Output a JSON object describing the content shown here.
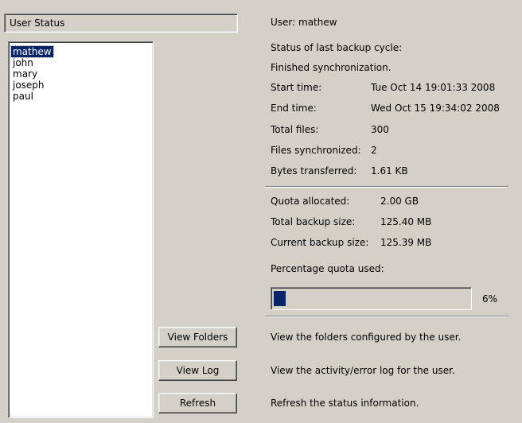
{
  "header": {
    "title": "User Status"
  },
  "users": {
    "selected_index": 0,
    "items": [
      "mathew",
      "john",
      "mary",
      "joseph",
      "paul"
    ]
  },
  "status": {
    "user_line": "User: mathew",
    "last_cycle_label": "Status of last backup cycle:",
    "last_cycle_value": "Finished synchronization.",
    "start_label": "Start time:",
    "start_value": "Tue Oct 14 19:01:33 2008",
    "end_label": "End time:",
    "end_value": "Wed Oct 15 19:34:02 2008",
    "total_files_label": "Total files:",
    "total_files_value": "300",
    "files_synced_label": "Files synchronized:",
    "files_synced_value": "2",
    "bytes_label": "Bytes transferred:",
    "bytes_value": "1.61 KB"
  },
  "quota": {
    "allocated_label": "Quota allocated:",
    "allocated_value": "2.00 GB",
    "total_label": "Total backup size:",
    "total_value": "125.40 MB",
    "current_label": "Current backup size:",
    "current_value": "125.39 MB",
    "percentage_label": "Percentage quota used:",
    "percent": 6,
    "percent_text": "6%"
  },
  "actions": {
    "view_folders_label": "View Folders",
    "view_folders_desc": "View the folders configured by the user.",
    "view_log_label": "View Log",
    "view_log_desc": "View the activity/error log for the user.",
    "refresh_label": "Refresh",
    "refresh_desc": "Refresh the status information."
  },
  "colors": {
    "background": "#d4d0c8",
    "selection": "#0a246a",
    "progress_fill": "#0a246a"
  }
}
